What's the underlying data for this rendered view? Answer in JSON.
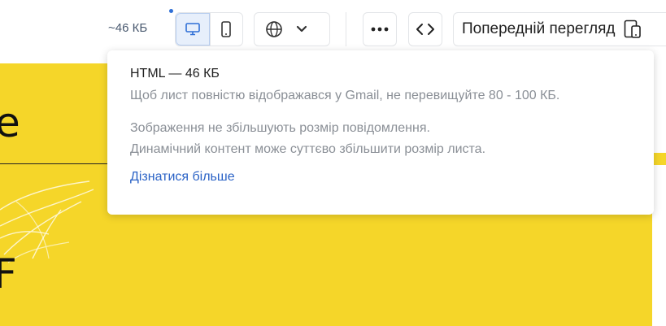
{
  "toolbar": {
    "size_indicator": "~46 КБ",
    "preview_label": "Попередній перегляд"
  },
  "icons": {
    "desktop": "desktop-icon",
    "mobile": "mobile-icon",
    "language": "globe-icon",
    "dropdown": "chevron-down-icon",
    "more": "more-horizontal-icon",
    "code": "code-icon",
    "preview": "device-preview-icon"
  },
  "popover": {
    "title": "HTML —  46 КБ",
    "lines_group1": [
      "Щоб лист повністю відображався у Gmail, не перевищуйте 80 - 100 КБ."
    ],
    "lines_group2": [
      "Зображення не збільшують розмір повідомлення.",
      "Динамічний контент може суттєво збільшити розмір листа."
    ],
    "link": "Дізнатися більше"
  },
  "colors": {
    "email_background": "#f5d629",
    "accent": "#2f6fd6",
    "link": "#2a62c6",
    "muted_text": "#8a8f96"
  }
}
